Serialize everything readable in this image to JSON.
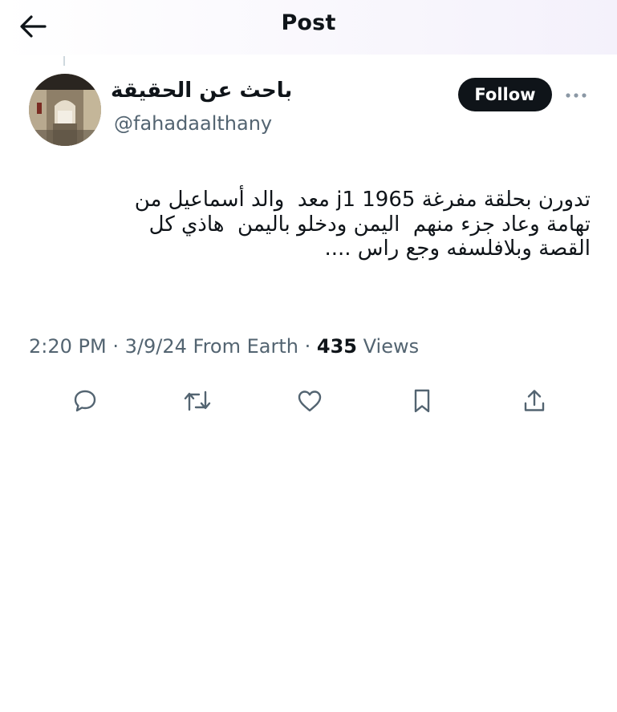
{
  "header": {
    "title": "Post",
    "back_icon": "arrow-left-icon"
  },
  "author": {
    "display_name": "باحث عن الحقيقة",
    "handle": "@fahadaalthany",
    "follow_label": "Follow",
    "more_icon": "more-horizontal-icon"
  },
  "tweet": {
    "lines": [
      "تدورن بحلقة مفرغة 1965 j1 معد  والد أسماعيل من",
      "تهامة وعاد جزء منهم  اليمن ودخلو باليمن  هاذي كل",
      "القصة وبلافلسفه وجع راس ...."
    ]
  },
  "meta": {
    "time": "2:20 PM",
    "separator": "·",
    "date": "3/9/24",
    "source": "From Earth",
    "views_count": "435",
    "views_label": "Views"
  },
  "actions": [
    {
      "name": "reply",
      "icon": "comment-icon"
    },
    {
      "name": "repost",
      "icon": "repost-icon"
    },
    {
      "name": "like",
      "icon": "heart-icon"
    },
    {
      "name": "bookmark",
      "icon": "bookmark-icon"
    },
    {
      "name": "share",
      "icon": "share-icon"
    }
  ],
  "colors": {
    "text_primary": "#0f1419",
    "text_secondary": "#536471",
    "follow_bg": "#0f1419",
    "follow_text": "#ffffff"
  }
}
